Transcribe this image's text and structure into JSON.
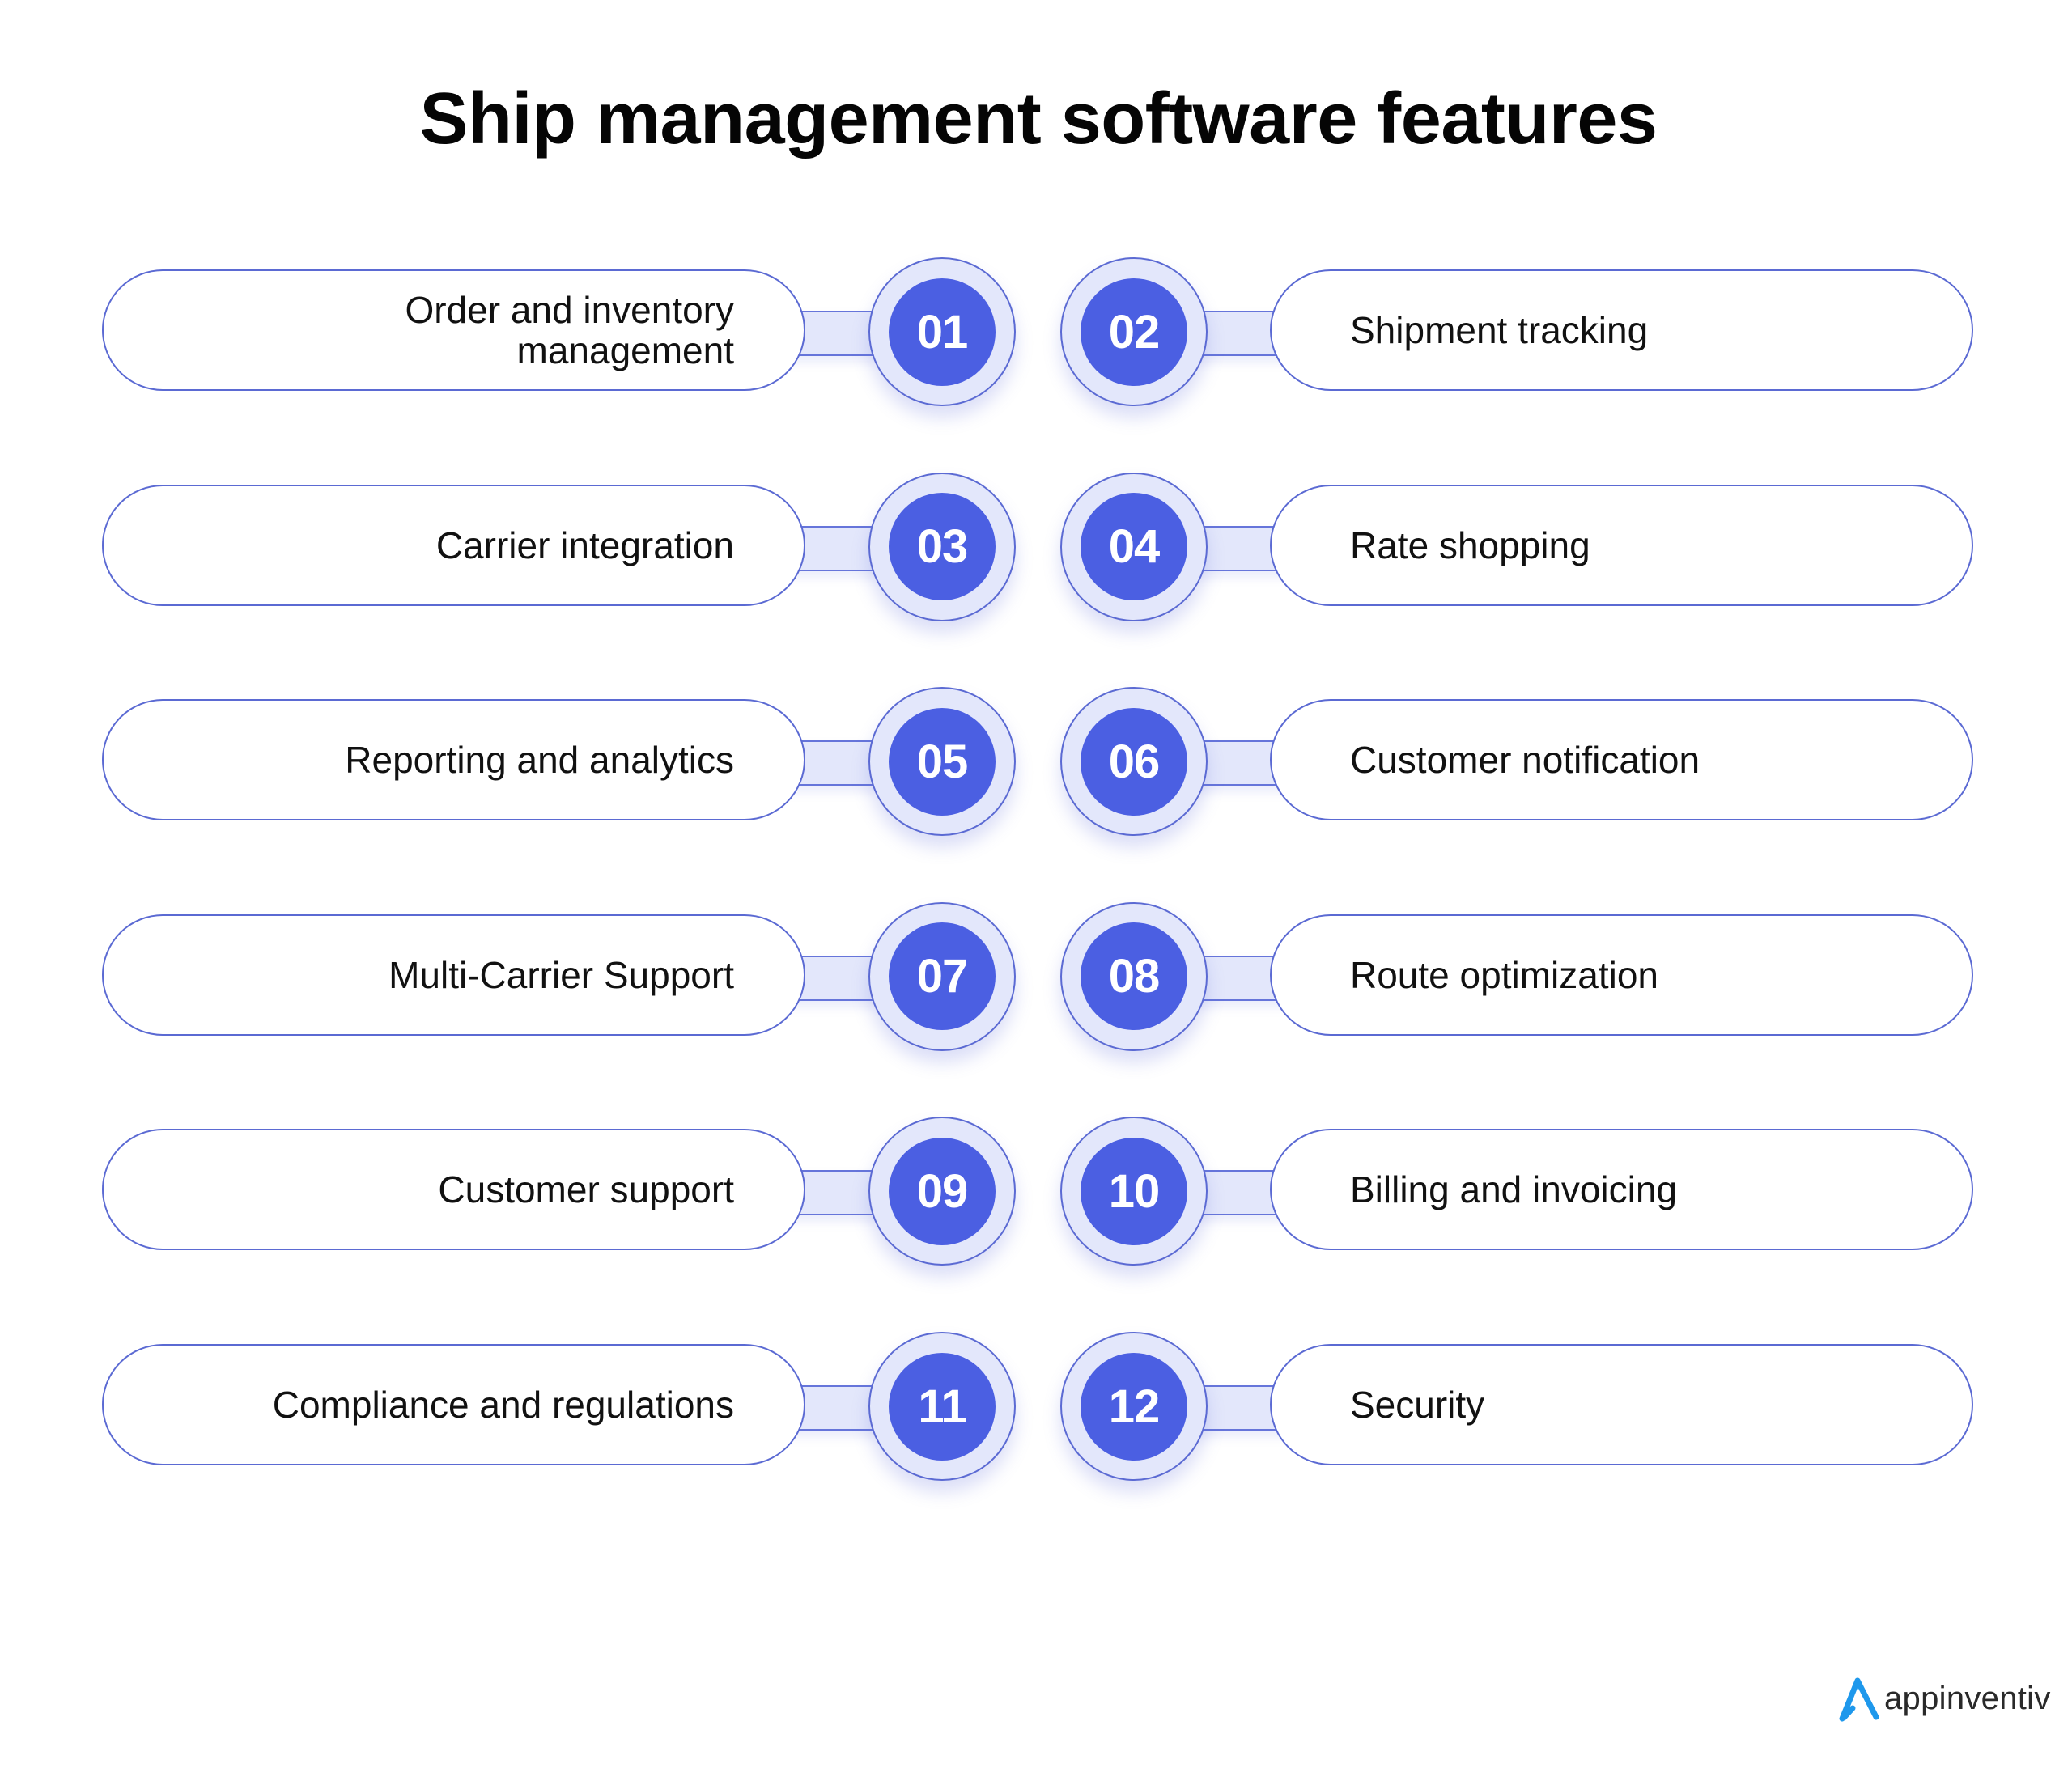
{
  "title": "Ship management software features",
  "colors": {
    "pill_border": "#5B6AD3",
    "badge_ring": "#E3E7FB",
    "badge_fill": "#4B5FE2",
    "badge_text": "#FFFFFF",
    "logo_blue": "#1E98EC"
  },
  "features": [
    {
      "number": "01",
      "label": "Order and inventory management",
      "lines": [
        "Order and inventory",
        "management"
      ],
      "side": "left"
    },
    {
      "number": "02",
      "label": "Shipment tracking",
      "side": "right"
    },
    {
      "number": "03",
      "label": "Carrier integration",
      "side": "left"
    },
    {
      "number": "04",
      "label": "Rate shopping",
      "side": "right"
    },
    {
      "number": "05",
      "label": "Reporting and analytics",
      "side": "left"
    },
    {
      "number": "06",
      "label": "Customer notification",
      "side": "right"
    },
    {
      "number": "07",
      "label": "Multi-Carrier Support",
      "side": "left"
    },
    {
      "number": "08",
      "label": "Route optimization",
      "side": "right"
    },
    {
      "number": "09",
      "label": "Customer support",
      "side": "left"
    },
    {
      "number": "10",
      "label": "Billing and invoicing",
      "side": "right"
    },
    {
      "number": "11",
      "label": "Compliance and regulations",
      "side": "left"
    },
    {
      "number": "12",
      "label": "Security",
      "side": "right"
    }
  ],
  "logo": {
    "icon": "appinventiv-logo-icon",
    "text": "appinventiv"
  }
}
